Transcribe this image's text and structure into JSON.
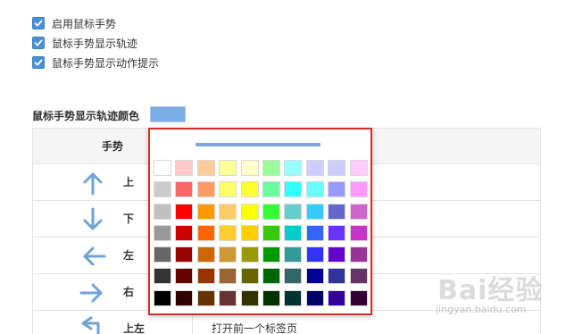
{
  "settings": {
    "checkboxes": [
      {
        "label": "启用鼠标手势",
        "checked": true
      },
      {
        "label": "鼠标手势显示轨迹",
        "checked": true
      },
      {
        "label": "鼠标手势显示动作提示",
        "checked": true
      }
    ],
    "trail_color_label": "鼠标手势显示轨迹颜色",
    "trail_color": "#7cace4"
  },
  "table": {
    "header": "手势",
    "rows": [
      {
        "icon": "arrow-up-icon",
        "gesture": "上",
        "action": ""
      },
      {
        "icon": "arrow-down-icon",
        "gesture": "下",
        "action": ""
      },
      {
        "icon": "arrow-left-icon",
        "gesture": "左",
        "action": ""
      },
      {
        "icon": "arrow-right-icon",
        "gesture": "右",
        "action": ""
      },
      {
        "icon": "arrow-up-left-icon",
        "gesture": "上左",
        "action": "打开前一个标签页"
      }
    ]
  },
  "color_picker": {
    "preview_color": "#7ca7d8",
    "palette": [
      [
        "#ffffff",
        "#ffc9c9",
        "#ffcc99",
        "#ffff99",
        "#ffffcc",
        "#99ff99",
        "#99ffff",
        "#ccccff",
        "#ccccff",
        "#ffccff"
      ],
      [
        "#cccccc",
        "#ff6666",
        "#ff9966",
        "#ffff66",
        "#ffff33",
        "#66ff99",
        "#33ffff",
        "#66ffff",
        "#9999ff",
        "#ff99ff"
      ],
      [
        "#c0c0c0",
        "#ff0000",
        "#ff9900",
        "#ffcc66",
        "#ffff00",
        "#33ff33",
        "#66cccc",
        "#33ccff",
        "#6666cc",
        "#cc66cc"
      ],
      [
        "#999999",
        "#cc0000",
        "#ff6600",
        "#ffcc33",
        "#ffcc00",
        "#33cc00",
        "#00cccc",
        "#3366ff",
        "#6633ff",
        "#cc33cc"
      ],
      [
        "#666666",
        "#990000",
        "#cc6600",
        "#cc9933",
        "#999900",
        "#009900",
        "#339999",
        "#3333ff",
        "#6600cc",
        "#993399"
      ],
      [
        "#333333",
        "#660000",
        "#993300",
        "#996633",
        "#666600",
        "#006600",
        "#336666",
        "#000099",
        "#333399",
        "#663366"
      ],
      [
        "#000000",
        "#330000",
        "#663300",
        "#663333",
        "#333300",
        "#003300",
        "#003333",
        "#000066",
        "#330099",
        "#330033"
      ]
    ]
  },
  "watermark": {
    "main": "Bai经验",
    "sub": "jingyan.baidu.com"
  }
}
